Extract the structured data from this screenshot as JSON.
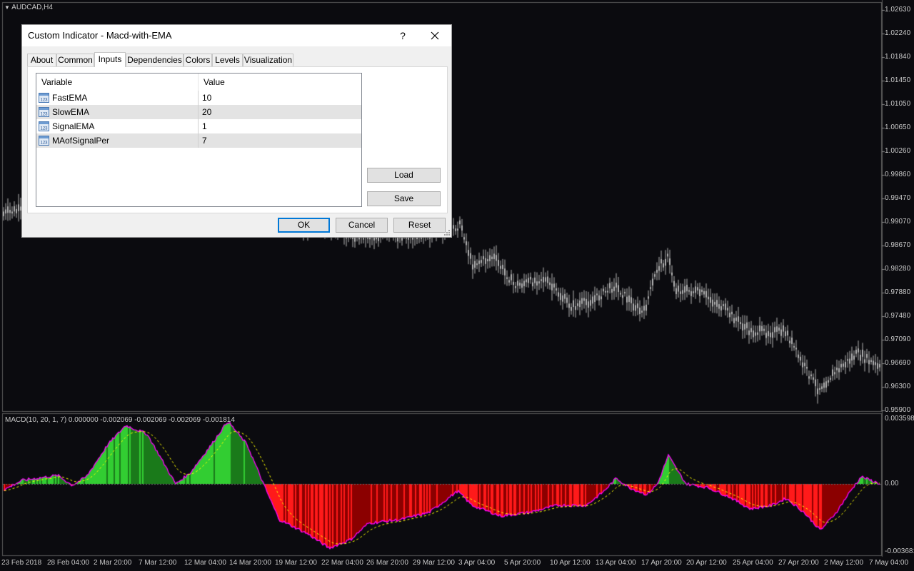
{
  "chart": {
    "symbol_label": "AUDCAD,H4",
    "colors": {
      "background": "#0b0b0f",
      "grid_frame": "#5a5a5a",
      "candle": "#b4b4b4",
      "axis_text": "#c8c8c8",
      "hist_up_bright": "#32cd32",
      "hist_up_dark": "#1a7a1a",
      "hist_down_bright": "#ff1a1a",
      "hist_down_dark": "#8b0000",
      "macd_line": "#ff00ff",
      "signal_line": "#ffff00"
    },
    "price_axis": [
      "1.02630",
      "1.02240",
      "1.01840",
      "1.01450",
      "1.01050",
      "1.00650",
      "1.00260",
      "0.99860",
      "0.99470",
      "0.99070",
      "0.98670",
      "0.98280",
      "0.97880",
      "0.97480",
      "0.97090",
      "0.96690",
      "0.96300",
      "0.95900"
    ],
    "time_axis": [
      "23 Feb 2018",
      "28 Feb 04:00",
      "2 Mar 20:00",
      "7 Mar 12:00",
      "12 Mar 04:00",
      "14 Mar 20:00",
      "19 Mar 12:00",
      "22 Mar 04:00",
      "26 Mar 20:00",
      "29 Mar 12:00",
      "3 Apr 04:00",
      "5 Apr 20:00",
      "10 Apr 12:00",
      "13 Apr 04:00",
      "17 Apr 20:00",
      "20 Apr 12:00",
      "25 Apr 04:00",
      "27 Apr 20:00",
      "2 May 12:00",
      "7 May 04:00"
    ],
    "price_range": [
      0.959,
      1.0263
    ]
  },
  "indicator": {
    "label": "MACD(10, 20, 1, 7) 0.000000 -0.002069 -0.002069 -0.002069 -0.001814",
    "axis": [
      "0.003598",
      "0.00",
      "-0.003681"
    ],
    "range": [
      -0.003681,
      0.003598
    ]
  },
  "dialog": {
    "title": "Custom Indicator - Macd-with-EMA",
    "help": "?",
    "tabs": [
      {
        "label": "About"
      },
      {
        "label": "Common"
      },
      {
        "label": "Inputs"
      },
      {
        "label": "Dependencies"
      },
      {
        "label": "Colors"
      },
      {
        "label": "Levels"
      },
      {
        "label": "Visualization"
      }
    ],
    "active_tab": "Inputs",
    "grid": {
      "columns": [
        "Variable",
        "Value"
      ],
      "rows": [
        {
          "variable": "FastEMA",
          "value": "10",
          "icon": "numeric-123-icon"
        },
        {
          "variable": "SlowEMA",
          "value": "20",
          "icon": "numeric-123-icon"
        },
        {
          "variable": "SignalEMA",
          "value": "1",
          "icon": "numeric-123-icon"
        },
        {
          "variable": "MAofSignalPer",
          "value": "7",
          "icon": "numeric-123-icon"
        }
      ]
    },
    "buttons": {
      "load": "Load",
      "save": "Save",
      "ok": "OK",
      "cancel": "Cancel",
      "reset": "Reset"
    }
  }
}
